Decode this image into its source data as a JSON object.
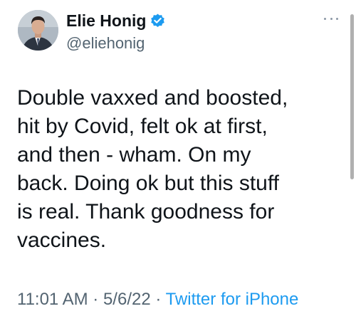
{
  "author": {
    "display_name": "Elie Honig",
    "handle": "@eliehonig",
    "avatar_icon": "profile-photo",
    "verified": true,
    "verified_icon": "verified-badge-icon",
    "verified_color": "#1d9bf0"
  },
  "tweet": {
    "text": "Double vaxxed and boosted,\nhit by Covid, felt ok at first,\nand then - wham. On my\nback. Doing ok but this stuff\nis real. Thank goodness for\nvaccines."
  },
  "meta": {
    "time": "11:01 AM",
    "separator": " · ",
    "date": "5/6/22",
    "source": "Twitter for iPhone",
    "link_color": "#1d9bf0"
  },
  "more_menu_icon": "more-options-icon"
}
